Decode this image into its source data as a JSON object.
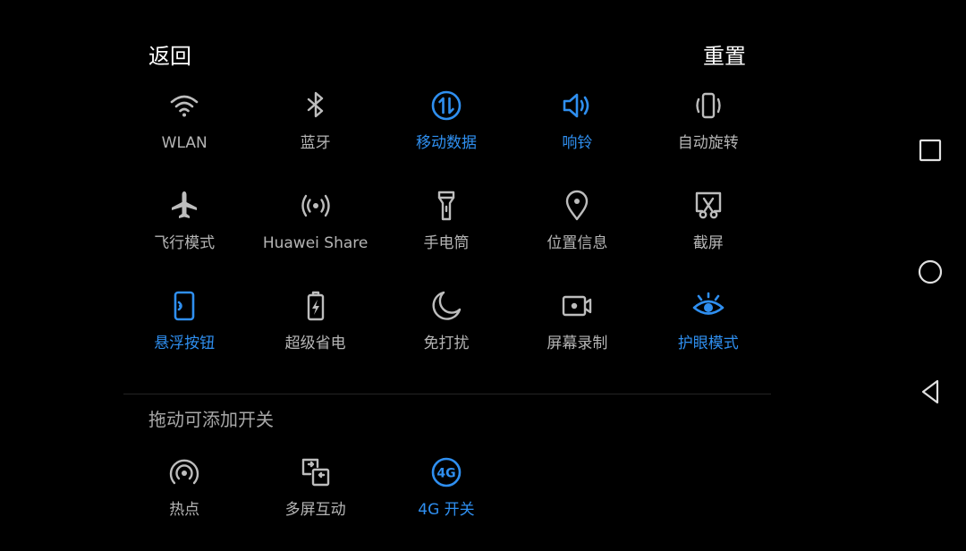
{
  "header": {
    "back_label": "返回",
    "reset_label": "重置"
  },
  "colors": {
    "background": "#000000",
    "inactive": "#bdbdbd",
    "active": "#2f8ff0",
    "text_white": "#ffffff"
  },
  "toggles": {
    "row1": [
      {
        "label": "WLAN",
        "icon": "wifi-icon",
        "active": false
      },
      {
        "label": "蓝牙",
        "icon": "bluetooth-icon",
        "active": false
      },
      {
        "label": "移动数据",
        "icon": "mobile-data-icon",
        "active": true
      },
      {
        "label": "响铃",
        "icon": "ring-icon",
        "active": true
      },
      {
        "label": "自动旋转",
        "icon": "auto-rotate-icon",
        "active": false
      }
    ],
    "row2": [
      {
        "label": "飞行模式",
        "icon": "airplane-icon",
        "active": false
      },
      {
        "label": "Huawei Share",
        "icon": "huawei-share-icon",
        "active": false
      },
      {
        "label": "手电筒",
        "icon": "flashlight-icon",
        "active": false
      },
      {
        "label": "位置信息",
        "icon": "location-icon",
        "active": false
      },
      {
        "label": "截屏",
        "icon": "screenshot-icon",
        "active": false
      }
    ],
    "row3": [
      {
        "label": "悬浮按钮",
        "icon": "floating-button-icon",
        "active": true
      },
      {
        "label": "超级省电",
        "icon": "power-saving-icon",
        "active": false
      },
      {
        "label": "免打扰",
        "icon": "do-not-disturb-icon",
        "active": false
      },
      {
        "label": "屏幕录制",
        "icon": "screen-record-icon",
        "active": false
      },
      {
        "label": "护眼模式",
        "icon": "eye-comfort-icon",
        "active": true
      }
    ]
  },
  "extra": {
    "hint": "拖动可添加开关",
    "items": [
      {
        "label": "热点",
        "icon": "hotspot-icon",
        "active": false
      },
      {
        "label": "多屏互动",
        "icon": "multi-screen-icon",
        "active": false
      },
      {
        "label": "4G 开关",
        "icon": "4g-icon",
        "active": true
      }
    ]
  },
  "navigation": {
    "recent": "recent-apps-icon",
    "home": "home-icon",
    "back": "back-icon"
  }
}
